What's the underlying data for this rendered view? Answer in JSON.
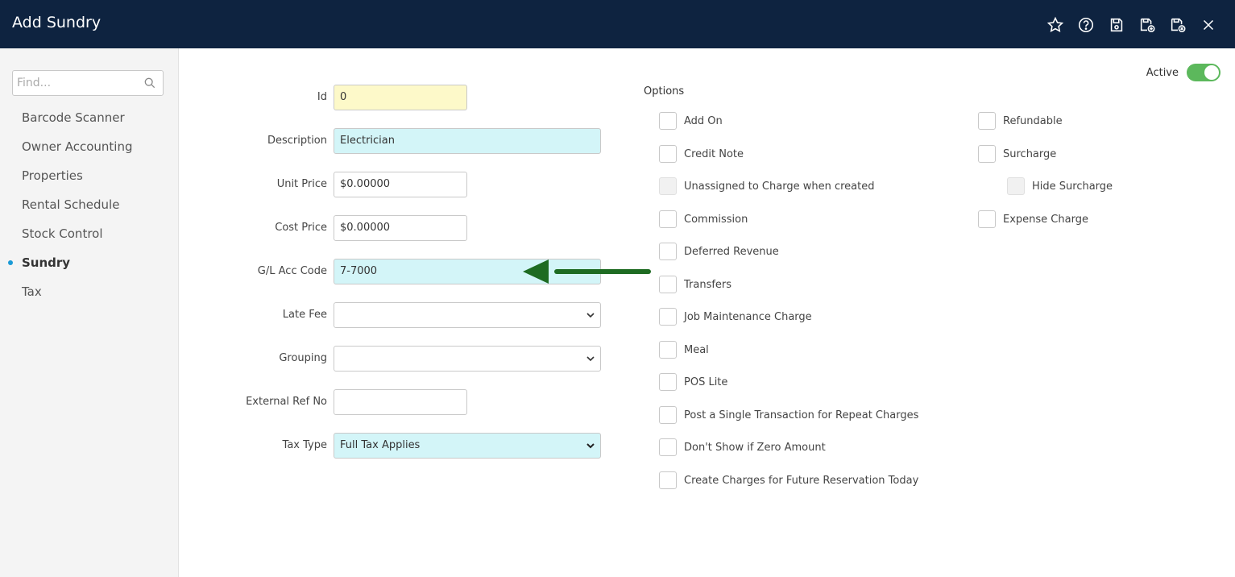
{
  "header": {
    "title": "Add Sundry"
  },
  "icons": [
    "star-icon",
    "help-icon",
    "save-icon",
    "save-new-icon",
    "save-close-icon",
    "close-icon"
  ],
  "sidebar": {
    "search_placeholder": "Find...",
    "items": [
      {
        "label": "Barcode Scanner",
        "active": false
      },
      {
        "label": "Owner Accounting",
        "active": false
      },
      {
        "label": "Properties",
        "active": false
      },
      {
        "label": "Rental Schedule",
        "active": false
      },
      {
        "label": "Stock Control",
        "active": false
      },
      {
        "label": "Sundry",
        "active": true
      },
      {
        "label": "Tax",
        "active": false
      }
    ]
  },
  "form": {
    "id": {
      "label": "Id",
      "value": "0"
    },
    "description": {
      "label": "Description",
      "value": "Electrician"
    },
    "unit_price": {
      "label": "Unit Price",
      "value": "$0.00000"
    },
    "cost_price": {
      "label": "Cost Price",
      "value": "$0.00000"
    },
    "gl_acc_code": {
      "label": "G/L Acc Code",
      "value": "7-7000"
    },
    "late_fee": {
      "label": "Late Fee",
      "value": ""
    },
    "grouping": {
      "label": "Grouping",
      "value": ""
    },
    "external_ref_no": {
      "label": "External Ref No",
      "value": ""
    },
    "tax_type": {
      "label": "Tax Type",
      "value": "Full Tax Applies"
    }
  },
  "options": {
    "title": "Options",
    "left": [
      {
        "label": "Add On",
        "checked": false,
        "disabled": false
      },
      {
        "label": "Credit Note",
        "checked": false,
        "disabled": false
      },
      {
        "label": "Unassigned to Charge when created",
        "checked": false,
        "disabled": true
      },
      {
        "label": "Commission",
        "checked": false,
        "disabled": false
      },
      {
        "label": "Deferred Revenue",
        "checked": false,
        "disabled": false
      },
      {
        "label": "Transfers",
        "checked": false,
        "disabled": false
      },
      {
        "label": "Job Maintenance Charge",
        "checked": false,
        "disabled": false
      },
      {
        "label": "Meal",
        "checked": false,
        "disabled": false
      },
      {
        "label": "POS Lite",
        "checked": false,
        "disabled": false
      },
      {
        "label": "Post a Single Transaction for Repeat Charges",
        "checked": false,
        "disabled": false
      },
      {
        "label": "Don't Show if Zero Amount",
        "checked": false,
        "disabled": false
      },
      {
        "label": "Create Charges for Future Reservation Today",
        "checked": false,
        "disabled": false
      }
    ],
    "right": [
      {
        "label": "Refundable",
        "checked": false,
        "disabled": false
      },
      {
        "label": "Surcharge",
        "checked": false,
        "disabled": false
      },
      {
        "label": "Hide Surcharge",
        "checked": false,
        "disabled": true
      },
      {
        "label": "Expense Charge",
        "checked": false,
        "disabled": false
      }
    ]
  },
  "status": {
    "active_label": "Active",
    "active": true
  },
  "annotation": {
    "arrow_color": "#1e6b22"
  }
}
